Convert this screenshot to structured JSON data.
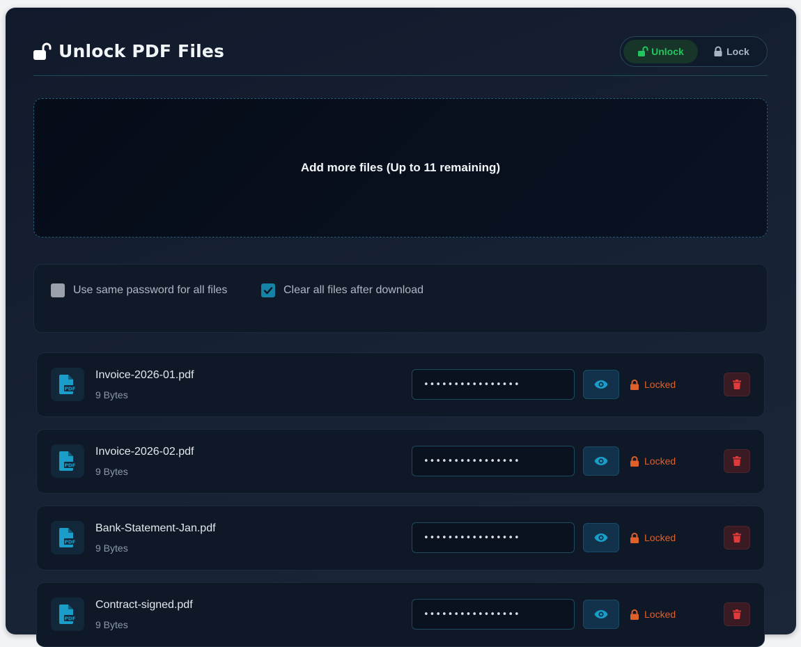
{
  "header": {
    "title": "Unlock PDF Files",
    "modes": [
      {
        "label": "Unlock",
        "active": true
      },
      {
        "label": "Lock",
        "active": false
      }
    ]
  },
  "dropzone": {
    "text": "Add more files (Up to 11 remaining)"
  },
  "options": [
    {
      "label": "Use same password for all files",
      "checked": false
    },
    {
      "label": "Clear all files after download",
      "checked": true
    }
  ],
  "files": [
    {
      "name": "Invoice-2026-01.pdf",
      "size": "9 Bytes",
      "password": "••••••••••••••••",
      "status": "Locked"
    },
    {
      "name": "Invoice-2026-02.pdf",
      "size": "9 Bytes",
      "password": "••••••••••••••••",
      "status": "Locked"
    },
    {
      "name": "Bank-Statement-Jan.pdf",
      "size": "9 Bytes",
      "password": "••••••••••••••••",
      "status": "Locked"
    },
    {
      "name": "Contract-signed.pdf",
      "size": "9 Bytes",
      "password": "••••••••••••••••",
      "status": "Locked"
    }
  ],
  "colors": {
    "accent": "#1583a7",
    "unlock_green": "#22c55e",
    "locked_orange": "#e0602a",
    "delete_red": "#e03a3a"
  }
}
